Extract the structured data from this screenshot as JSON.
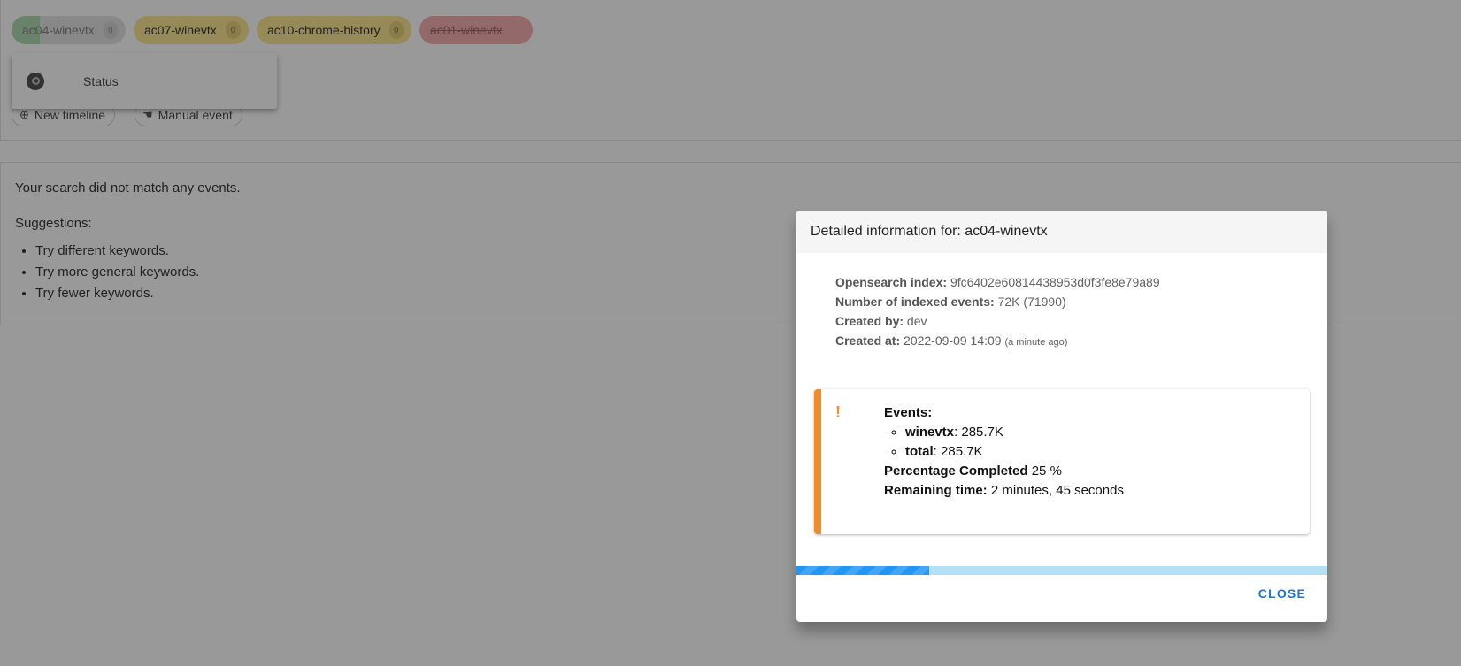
{
  "timelines": [
    {
      "label": "ac04-winevtx",
      "count": "0"
    },
    {
      "label": "ac07-winevtx",
      "count": "0"
    },
    {
      "label": "ac10-chrome-history",
      "count": "0"
    },
    {
      "label": "ac01-winevtx"
    }
  ],
  "status_menu": {
    "label": "Status"
  },
  "actions": {
    "new_timeline": "New timeline",
    "manual_event": "Manual event"
  },
  "results": {
    "message": "Your search did not match any events.",
    "suggestions_heading": "Suggestions:",
    "suggestions": [
      "Try different keywords.",
      "Try more general keywords.",
      "Try fewer keywords."
    ]
  },
  "dialog": {
    "title": "Detailed information for: ac04-winevtx",
    "info": {
      "index_label": "Opensearch index:",
      "index_value": "9fc6402e60814438953d0f3fe8e79a89",
      "events_label": "Number of indexed events:",
      "events_value": "72K (71990)",
      "created_by_label": "Created by:",
      "created_by_value": "dev",
      "created_at_label": "Created at:",
      "created_at_value": "2022-09-09 14:09",
      "created_at_relative": "(a minute ago)"
    },
    "alert": {
      "warn_icon": "!",
      "events_label": "Events:",
      "items": [
        {
          "name": "winevtx",
          "value": ": 285.7K"
        },
        {
          "name": "total",
          "value": ": 285.7K"
        }
      ],
      "percent_label": "Percentage Completed",
      "percent_value": "25 %",
      "remaining_label": "Remaining time:",
      "remaining_value": "2 minutes, 45 seconds"
    },
    "progress_fraction": 0.25,
    "close_label": "CLOSE"
  },
  "colors": {
    "accent": "#1976d2",
    "warning": "#f28c28",
    "progress": "#2196f3"
  }
}
